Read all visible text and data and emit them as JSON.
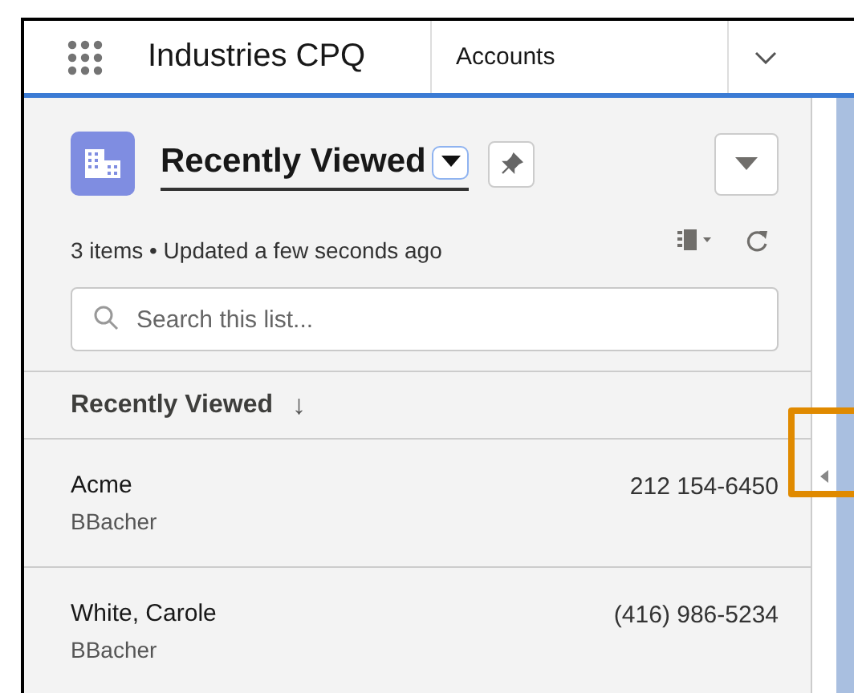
{
  "top_bar": {
    "app_name": "Industries CPQ",
    "tab": "Accounts"
  },
  "list_view": {
    "title": "Recently Viewed",
    "meta": "3 items • Updated a few seconds ago",
    "search": {
      "placeholder": "Search this list..."
    },
    "sort_header": "Recently Viewed",
    "sort_arrow": "↓",
    "rows": [
      {
        "name": "Acme",
        "owner": "BBacher",
        "phone": "212 154-6450"
      },
      {
        "name": "White, Carole",
        "owner": "BBacher",
        "phone": "(416) 986-5234"
      }
    ]
  },
  "collapse_handle": {
    "highlighted": true
  }
}
